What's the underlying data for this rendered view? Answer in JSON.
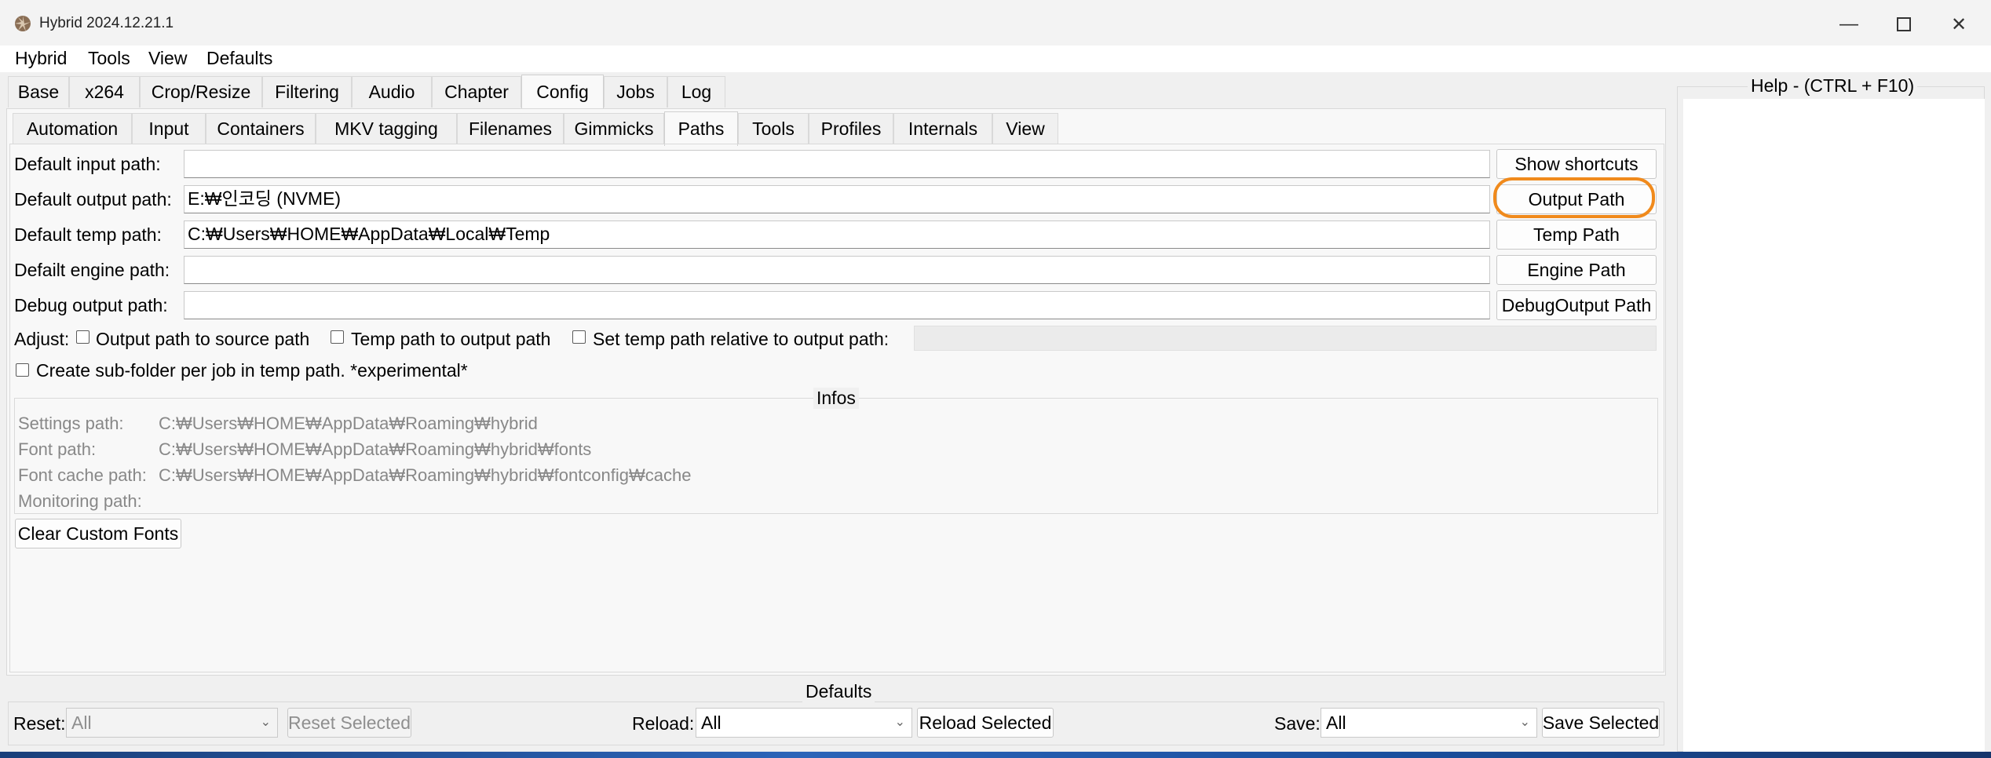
{
  "window": {
    "title": "Hybrid 2024.12.21.1",
    "controls": [
      "minimize",
      "maximize",
      "close"
    ]
  },
  "menu": [
    "Hybrid",
    "Tools",
    "View",
    "Defaults"
  ],
  "main_tabs": [
    "Base",
    "x264",
    "Crop/Resize",
    "Filtering",
    "Audio",
    "Chapter",
    "Config",
    "Jobs",
    "Log"
  ],
  "main_tab_active": "Config",
  "sub_tabs": [
    "Automation",
    "Input",
    "Containers",
    "MKV tagging",
    "Filenames",
    "Gimmicks",
    "Paths",
    "Tools",
    "Profiles",
    "Internals",
    "View"
  ],
  "sub_tab_active": "Paths",
  "paths": [
    {
      "label": "Default input path:",
      "value": "",
      "button": "Show shortcuts"
    },
    {
      "label": "Default output path:",
      "value": "E:₩인코딩 (NVME)",
      "button": "Output Path"
    },
    {
      "label": "Default temp path:",
      "value": "C:₩Users₩HOME₩AppData₩Local₩Temp",
      "button": "Temp Path"
    },
    {
      "label": "Defailt engine path:",
      "value": "",
      "button": "Engine Path"
    },
    {
      "label": "Debug output path:",
      "value": "",
      "button": "DebugOutput Path"
    }
  ],
  "highlight_color": "#f08a1c",
  "adjust": {
    "label": "Adjust:",
    "options": [
      "Output path to source path",
      "Temp path to output path",
      "Set temp path relative to output path:"
    ],
    "subfolder": "Create sub-folder per job in temp path. *experimental*"
  },
  "infos": {
    "title": "Infos",
    "rows": [
      {
        "label": "Settings path:",
        "value": "C:₩Users₩HOME₩AppData₩Roaming₩hybrid"
      },
      {
        "label": "Font path:",
        "value": "C:₩Users₩HOME₩AppData₩Roaming₩hybrid₩fonts"
      },
      {
        "label": "Font cache path:",
        "value": "C:₩Users₩HOME₩AppData₩Roaming₩hybrid₩fontconfig₩cache"
      },
      {
        "label": "Monitoring path:",
        "value": ""
      }
    ]
  },
  "clear_fonts_button": "Clear Custom Fonts",
  "defaults": {
    "title": "Defaults",
    "reset_label": "Reset:",
    "reset_value": "All",
    "reset_button": "Reset Selected",
    "reload_label": "Reload:",
    "reload_value": "All",
    "reload_button": "Reload Selected",
    "save_label": "Save:",
    "save_value": "All",
    "save_button": "Save Selected"
  },
  "help": {
    "title": "Help - (CTRL + F10)"
  }
}
